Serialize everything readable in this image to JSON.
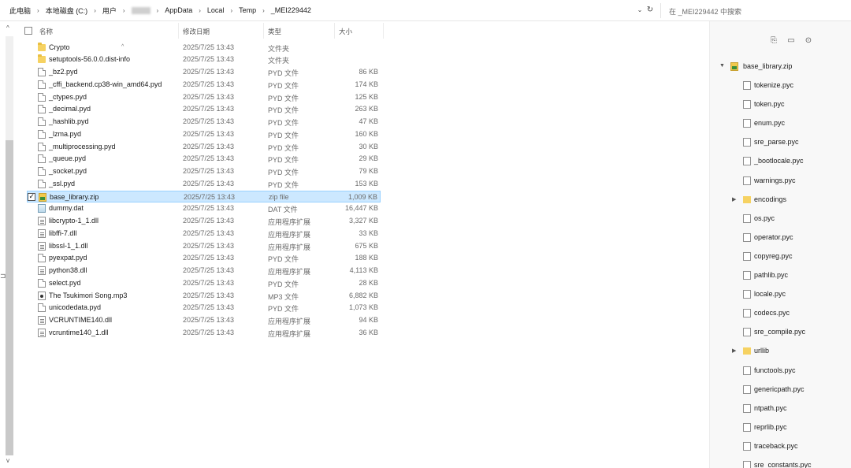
{
  "address": {
    "crumbs": [
      "此电脑",
      "本地磁盘 (C:)",
      "用户",
      "",
      "AppData",
      "Local",
      "Temp",
      "_MEI229442"
    ],
    "search_placeholder": "在 _MEI229442 中搜索"
  },
  "columns": {
    "name": "名称",
    "date": "修改日期",
    "type": "类型",
    "size": "大小"
  },
  "files": [
    {
      "name": "Crypto",
      "date": "2025/7/25 13:43",
      "type": "文件夹",
      "size": "",
      "icon": "folder"
    },
    {
      "name": "setuptools-56.0.0.dist-info",
      "date": "2025/7/25 13:43",
      "type": "文件夹",
      "size": "",
      "icon": "folder"
    },
    {
      "name": "_bz2.pyd",
      "date": "2025/7/25 13:43",
      "type": "PYD 文件",
      "size": "86 KB",
      "icon": "file"
    },
    {
      "name": "_cffi_backend.cp38-win_amd64.pyd",
      "date": "2025/7/25 13:43",
      "type": "PYD 文件",
      "size": "174 KB",
      "icon": "file"
    },
    {
      "name": "_ctypes.pyd",
      "date": "2025/7/25 13:43",
      "type": "PYD 文件",
      "size": "125 KB",
      "icon": "file"
    },
    {
      "name": "_decimal.pyd",
      "date": "2025/7/25 13:43",
      "type": "PYD 文件",
      "size": "263 KB",
      "icon": "file"
    },
    {
      "name": "_hashlib.pyd",
      "date": "2025/7/25 13:43",
      "type": "PYD 文件",
      "size": "47 KB",
      "icon": "file"
    },
    {
      "name": "_lzma.pyd",
      "date": "2025/7/25 13:43",
      "type": "PYD 文件",
      "size": "160 KB",
      "icon": "file"
    },
    {
      "name": "_multiprocessing.pyd",
      "date": "2025/7/25 13:43",
      "type": "PYD 文件",
      "size": "30 KB",
      "icon": "file"
    },
    {
      "name": "_queue.pyd",
      "date": "2025/7/25 13:43",
      "type": "PYD 文件",
      "size": "29 KB",
      "icon": "file"
    },
    {
      "name": "_socket.pyd",
      "date": "2025/7/25 13:43",
      "type": "PYD 文件",
      "size": "79 KB",
      "icon": "file"
    },
    {
      "name": "_ssl.pyd",
      "date": "2025/7/25 13:43",
      "type": "PYD 文件",
      "size": "153 KB",
      "icon": "file"
    },
    {
      "name": "base_library.zip",
      "date": "2025/7/25 13:43",
      "type": "zip file",
      "size": "1,009 KB",
      "icon": "zip",
      "selected": true
    },
    {
      "name": "dummy.dat",
      "date": "2025/7/25 13:43",
      "type": "DAT 文件",
      "size": "16,447 KB",
      "icon": "dat"
    },
    {
      "name": "libcrypto-1_1.dll",
      "date": "2025/7/25 13:43",
      "type": "应用程序扩展",
      "size": "3,327 KB",
      "icon": "dll"
    },
    {
      "name": "libffi-7.dll",
      "date": "2025/7/25 13:43",
      "type": "应用程序扩展",
      "size": "33 KB",
      "icon": "dll"
    },
    {
      "name": "libssl-1_1.dll",
      "date": "2025/7/25 13:43",
      "type": "应用程序扩展",
      "size": "675 KB",
      "icon": "dll"
    },
    {
      "name": "pyexpat.pyd",
      "date": "2025/7/25 13:43",
      "type": "PYD 文件",
      "size": "188 KB",
      "icon": "file"
    },
    {
      "name": "python38.dll",
      "date": "2025/7/25 13:43",
      "type": "应用程序扩展",
      "size": "4,113 KB",
      "icon": "dll"
    },
    {
      "name": "select.pyd",
      "date": "2025/7/25 13:43",
      "type": "PYD 文件",
      "size": "28 KB",
      "icon": "file"
    },
    {
      "name": "The Tsukimori Song.mp3",
      "date": "2025/7/25 13:43",
      "type": "MP3 文件",
      "size": "6,882 KB",
      "icon": "mp3"
    },
    {
      "name": "unicodedata.pyd",
      "date": "2025/7/25 13:43",
      "type": "PYD 文件",
      "size": "1,073 KB",
      "icon": "file"
    },
    {
      "name": "VCRUNTIME140.dll",
      "date": "2025/7/25 13:43",
      "type": "应用程序扩展",
      "size": "94 KB",
      "icon": "dll"
    },
    {
      "name": "vcruntime140_1.dll",
      "date": "2025/7/25 13:43",
      "type": "应用程序扩展",
      "size": "36 KB",
      "icon": "dll"
    }
  ],
  "tree": {
    "root": "base_library.zip",
    "items": [
      {
        "name": "tokenize.pyc",
        "kind": "file"
      },
      {
        "name": "token.pyc",
        "kind": "file"
      },
      {
        "name": "enum.pyc",
        "kind": "file"
      },
      {
        "name": "sre_parse.pyc",
        "kind": "file"
      },
      {
        "name": "_bootlocale.pyc",
        "kind": "file"
      },
      {
        "name": "warnings.pyc",
        "kind": "file"
      },
      {
        "name": "encodings",
        "kind": "folder"
      },
      {
        "name": "os.pyc",
        "kind": "file"
      },
      {
        "name": "operator.pyc",
        "kind": "file"
      },
      {
        "name": "copyreg.pyc",
        "kind": "file"
      },
      {
        "name": "pathlib.pyc",
        "kind": "file"
      },
      {
        "name": "locale.pyc",
        "kind": "file"
      },
      {
        "name": "codecs.pyc",
        "kind": "file"
      },
      {
        "name": "sre_compile.pyc",
        "kind": "file"
      },
      {
        "name": "urllib",
        "kind": "folder"
      },
      {
        "name": "functools.pyc",
        "kind": "file"
      },
      {
        "name": "genericpath.pyc",
        "kind": "file"
      },
      {
        "name": "ntpath.pyc",
        "kind": "file"
      },
      {
        "name": "reprlib.pyc",
        "kind": "file"
      },
      {
        "name": "traceback.pyc",
        "kind": "file"
      },
      {
        "name": "sre_constants.pyc",
        "kind": "file"
      }
    ]
  }
}
